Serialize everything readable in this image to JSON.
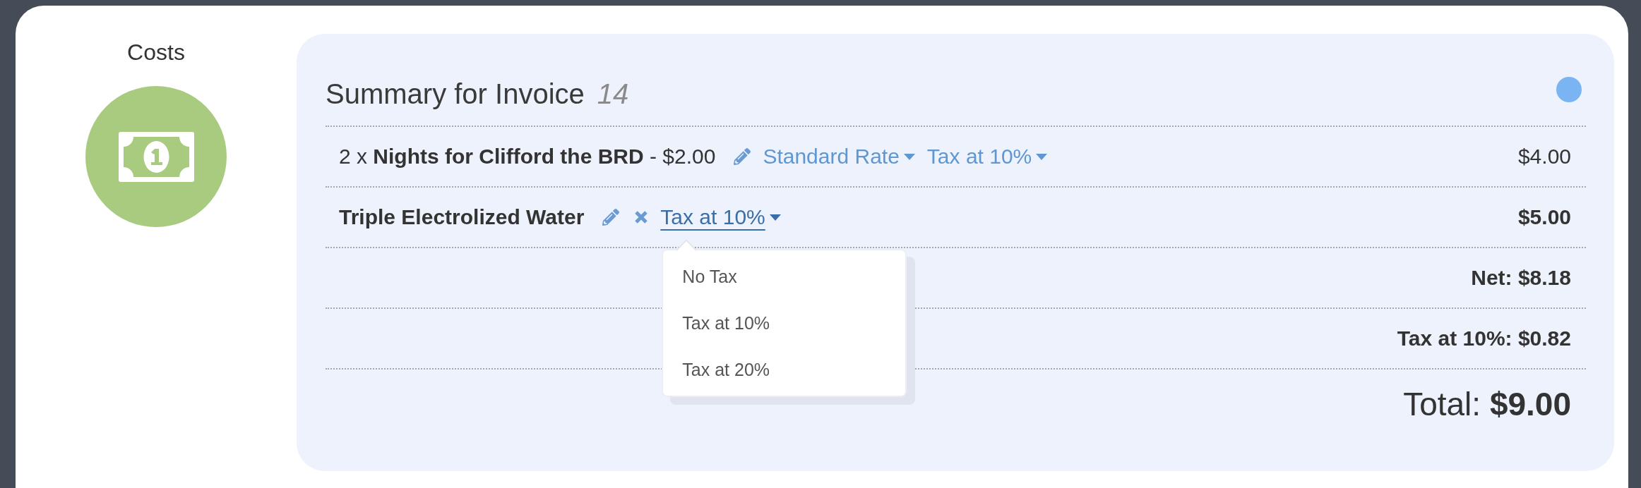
{
  "section": {
    "title": "Costs"
  },
  "invoice": {
    "title": "Summary for Invoice",
    "number": "14"
  },
  "items": [
    {
      "kind": "service",
      "description": "2 x **Nights for Clifford the BRD** - $2.00",
      "rate": "Standard Rate",
      "tax": {
        "label": "Tax at 10%",
        "expanded": false
      },
      "amount": "$4.00"
    },
    {
      "kind": "product",
      "description": "Triple Electrolized Water",
      "tax": {
        "label": "Tax at 10%",
        "expanded": true,
        "options": [
          "No Tax",
          "Tax at 10%",
          "Tax at 20%"
        ]
      },
      "amount": "$5.00"
    }
  ],
  "totals": [
    "Net: $8.18",
    "Tax at 10%: $0.82"
  ],
  "total": "Total: **$9.00**"
}
